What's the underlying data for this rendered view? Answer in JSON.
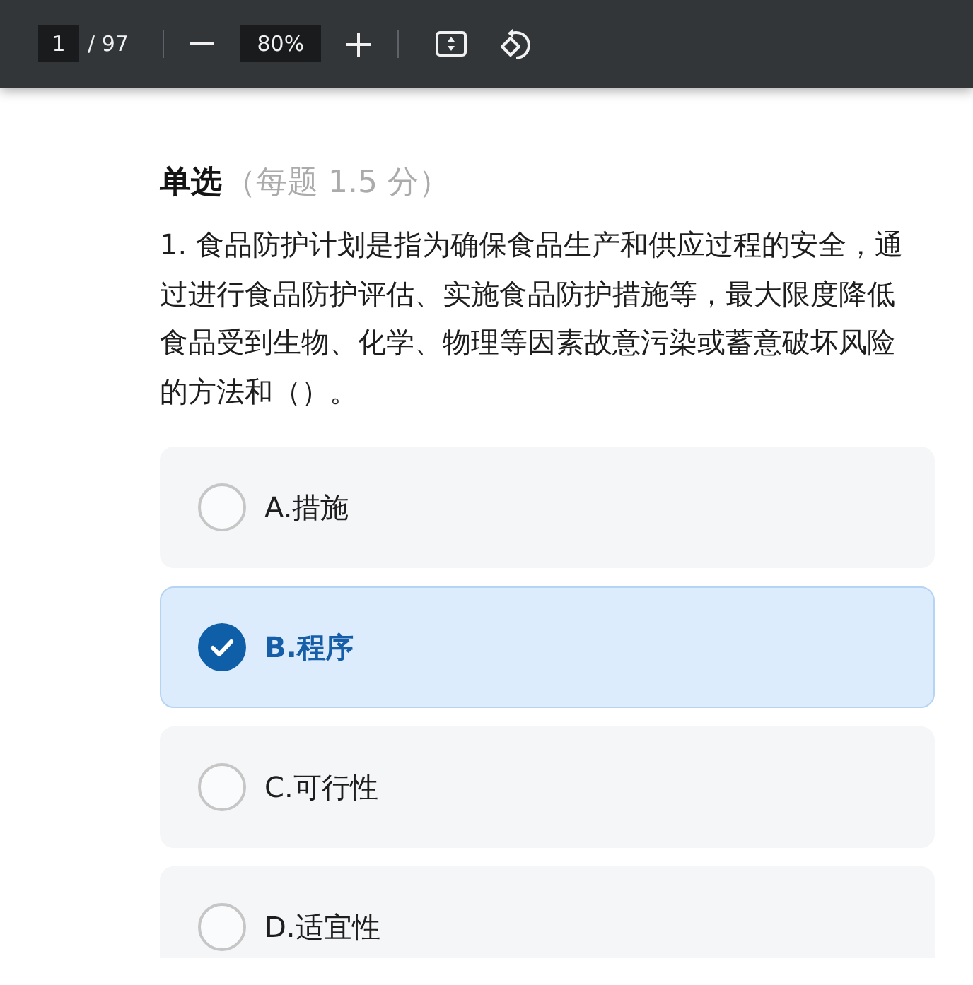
{
  "toolbar": {
    "page_number": "1",
    "page_count": "/ 97",
    "zoom": "80%"
  },
  "section": {
    "title": "单选",
    "score_note": "（每题 1.5 分）"
  },
  "question": {
    "text": "1. 食品防护计划是指为确保食品生产和供应过程的安全，通过进行食品防护评估、实施食品防护措施等，最大限度降低食品受到生物、化学、物理等因素故意污染或蓄意破坏风险的方法和（）。"
  },
  "options": [
    {
      "label": "A.措施",
      "selected": false
    },
    {
      "label": "B.程序",
      "selected": true
    },
    {
      "label": "C.可行性",
      "selected": false
    },
    {
      "label": "D.适宜性",
      "selected": false
    }
  ]
}
